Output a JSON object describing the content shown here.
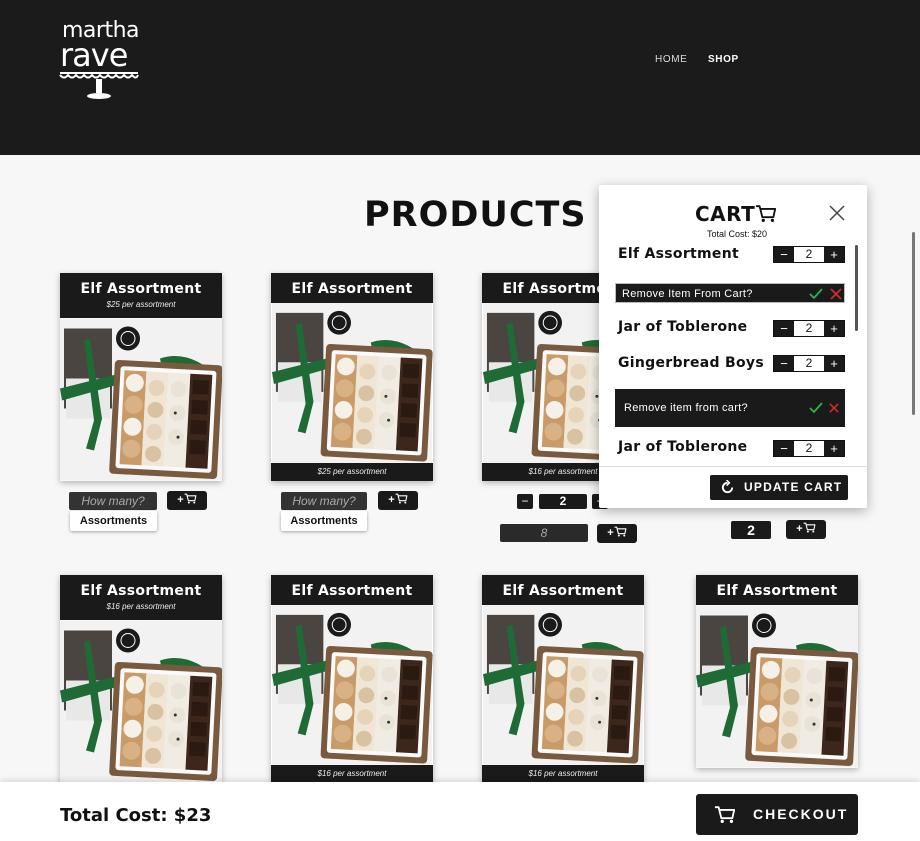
{
  "header": {
    "logo_line1": "martha",
    "logo_line2": "rave",
    "nav": [
      {
        "label": "HOME"
      },
      {
        "label": "SHOP"
      }
    ]
  },
  "page_title": "PRODUCTS",
  "products": [
    {
      "name": "Elf Assortment",
      "price": "$25 per assortment"
    },
    {
      "name": "Elf Assortment",
      "price": "$25 per assortment"
    },
    {
      "name": "Elf Assortment",
      "price": "$16 per assortment"
    },
    {
      "name": "Elf Assortment",
      "price": "$16 per assortment"
    },
    {
      "name": "Elf Assortment",
      "price": "$16 per assortment"
    },
    {
      "name": "Elf Assortment",
      "price": "$16 per assortment"
    }
  ],
  "controls": {
    "howmany_placeholder": "How many?",
    "assortments_label": "Assortments",
    "add_label": "+",
    "qty_value": "2",
    "qty_input_value": "8",
    "minus": "−",
    "plus": "+"
  },
  "cart": {
    "title": "CART",
    "total": "Total Cost: $20",
    "items": [
      {
        "name": "Elf Assortment",
        "qty": "2"
      },
      {
        "name": "Jar of Toblerone",
        "qty": "2"
      },
      {
        "name": "Gingerbread Boys",
        "qty": "2"
      },
      {
        "name": "Jar of Toblerone",
        "qty": "2"
      }
    ],
    "confirm_1": "Remove Item From Cart?",
    "confirm_2": "Remove item from cart?",
    "update_label": "UPDATE CART"
  },
  "footer": {
    "total": "Total Cost: $23",
    "checkout_label": "CHECKOUT"
  },
  "colors": {
    "header_bg": "#1b1b1b",
    "accent_dark": "#1a1a1a",
    "confirm_green": "#2fb24a",
    "cancel_red": "#d42a2a",
    "ribbon_green": "#1f6b35"
  }
}
